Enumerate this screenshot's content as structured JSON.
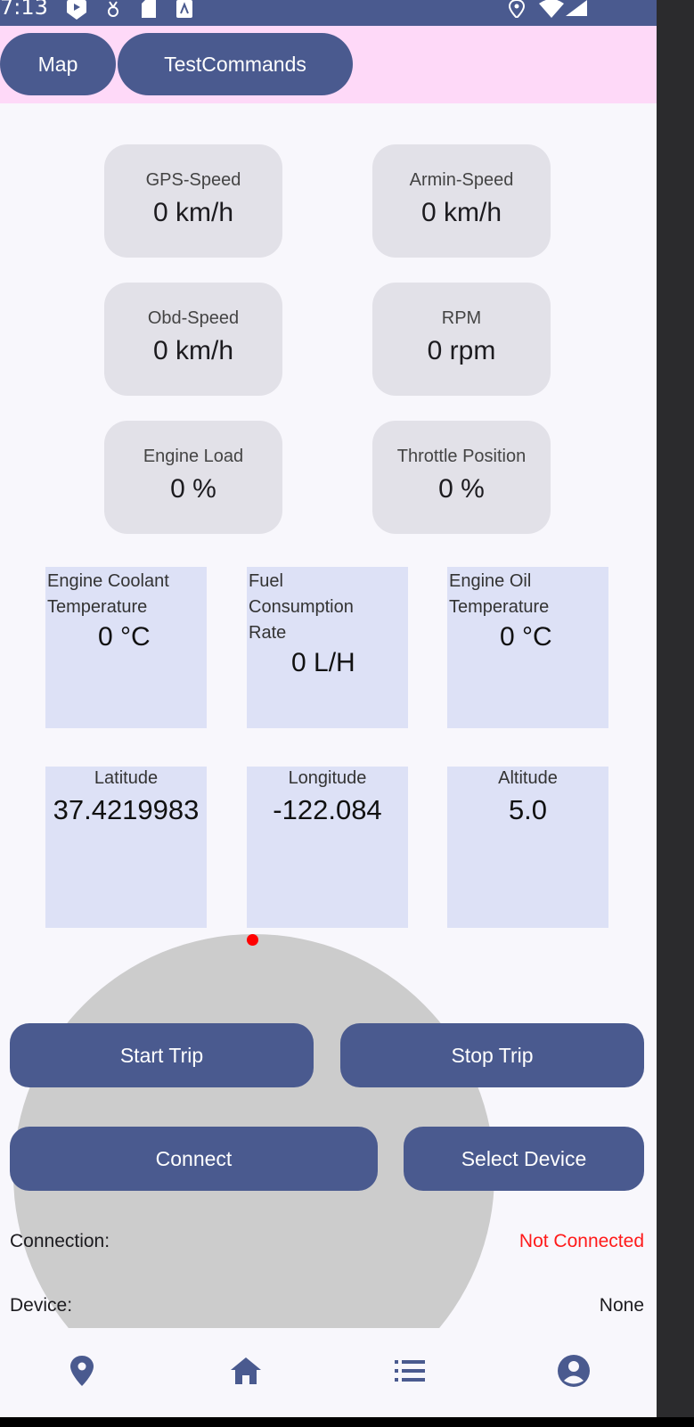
{
  "status_bar": {
    "time": "7:13"
  },
  "top_tabs": [
    {
      "label": "Map"
    },
    {
      "label": "TestCommands"
    }
  ],
  "gauges": [
    {
      "label": "GPS-Speed",
      "value": "0 km/h"
    },
    {
      "label": "Armin-Speed",
      "value": "0 km/h"
    },
    {
      "label": "Obd-Speed",
      "value": "0 km/h"
    },
    {
      "label": "RPM",
      "value": "0 rpm"
    },
    {
      "label": "Engine Load",
      "value": "0 %"
    },
    {
      "label": "Throttle Position",
      "value": "0 %"
    }
  ],
  "panels": [
    {
      "label": "Engine Coolant\nTemperature",
      "value": "0 °C"
    },
    {
      "label": "Fuel\nConsumption\nRate",
      "value": "0 L/H"
    },
    {
      "label": "Engine Oil\nTemperature",
      "value": "0 °C"
    }
  ],
  "location": [
    {
      "label": "Latitude",
      "value": "37.4219983"
    },
    {
      "label": "Longitude",
      "value": "-122.084"
    },
    {
      "label": "Altitude",
      "value": "5.0"
    }
  ],
  "buttons": {
    "start_trip": "Start Trip",
    "stop_trip": "Stop Trip",
    "connect": "Connect",
    "select_device": "Select Device"
  },
  "info": {
    "connection_label": "Connection:",
    "connection_value": "Not Connected",
    "device_label": "Device:",
    "device_value": "None"
  },
  "colors": {
    "accent": "#4a5a8f",
    "top_bar": "#fed9f8",
    "gauge_bg": "#e2e1e8",
    "panel_bg": "#dde1f6",
    "error": "#ff1a1a"
  },
  "bottom_nav": [
    {
      "icon": "location-pin-icon"
    },
    {
      "icon": "home-icon"
    },
    {
      "icon": "list-icon"
    },
    {
      "icon": "account-icon"
    }
  ]
}
